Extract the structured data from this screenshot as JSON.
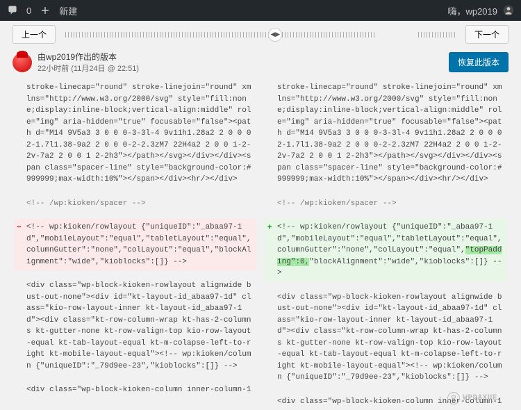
{
  "adminbar": {
    "comment_count": "0",
    "new_label": "新建",
    "greeting": "嗨，wp2019"
  },
  "nav": {
    "prev": "上一个",
    "next": "下一个"
  },
  "revision": {
    "author_line": "由wp2019作出的版本",
    "meta": "22小时前 (11月24日 @ 22:51)",
    "restore_label": "恢复此版本"
  },
  "diff": {
    "shared_top": "stroke-linecap=\"round\" stroke-linejoin=\"round\" xmlns=\"http://www.w3.org/2000/svg\" style=\"fill:none;display:inline-block;vertical-align:middle\" role=\"img\" aria-hidden=\"true\" focusable=\"false\"><path d=\"M14 9V5a3 3 0 0 0-3-3l-4 9v11h1.28a2 2 0 0 0 2-1.7l1.38-9a2 2 0 0 0-2-2.3zM7 22H4a2 2 0 0 1-2-2v-7a2 2 0 0 1 2-2h3\"></path></svg></div></div><span class=\"spacer-line\" style=\"background-color:#999999;max-width:10%\"></span></div><hr/></div>",
    "close_comment": "<!-- /wp:kioken/spacer -->",
    "left_changed": "<!-- wp:kioken/rowlayout {\"uniqueID\":\"_abaa97-1d\",\"mobileLayout\":\"equal\",\"tabletLayout\":\"equal\",columnGutter\":\"none\",\"colLayout\":\"equal\",\"blockAlignment\":\"wide\",\"kioblocks\":[]} -->",
    "right_changed_pre": "<!-- wp:kioken/rowlayout {\"uniqueID\":\"_abaa97-1d\",\"mobileLayout\":\"equal\",\"tabletLayout\":\"equal\",columnGutter\":\"none\",\"colLayout\":\"equal\",",
    "right_highlight": "\"topPadding\":0,",
    "right_changed_post": "\"blockAlignment\":\"wide\",\"kioblocks\":[]} -->",
    "shared_mid": "<div class=\"wp-block-kioken-rowlayout alignwide bust-out-none\"><div id=\"kt-layout-id_abaa97-1d\" class=\"kio-row-layout-inner kt-layout-id_abaa97-1d\"><div class=\"kt-row-column-wrap kt-has-2-columns kt-gutter-none kt-row-valign-top kio-row-layout-equal kt-tab-layout-equal kt-m-colapse-left-to-right kt-mobile-layout-equal\"><!-- wp:kioken/column {\"uniqueID\":\"_79d9ee-23\",\"kioblocks\":[]} -->",
    "shared_bottom": "<div class=\"wp-block-kioken-column inner-column-1"
  },
  "watermark": "WPDAXUE"
}
